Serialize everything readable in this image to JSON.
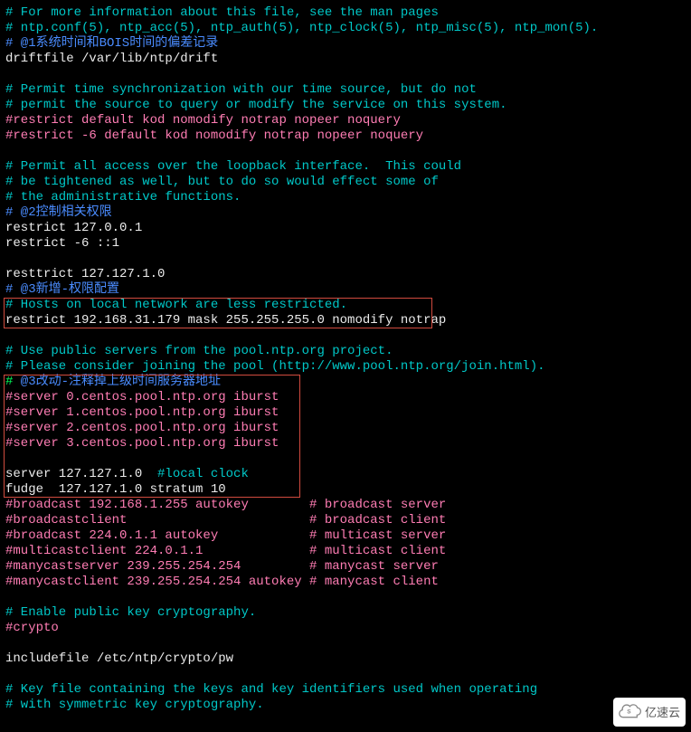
{
  "lines": [
    {
      "parts": [
        {
          "cls": "c-teal",
          "text": "# For more information about this file, see the man pages"
        }
      ]
    },
    {
      "parts": [
        {
          "cls": "c-teal",
          "text": "# ntp.conf(5), ntp_acc(5), ntp_auth(5), ntp_clock(5), ntp_misc(5), ntp_mon(5)."
        }
      ]
    },
    {
      "parts": [
        {
          "cls": "c-blue",
          "text": "# @1系统时间和BOIS时间的偏差记录"
        }
      ]
    },
    {
      "parts": [
        {
          "cls": "c-white",
          "text": "driftfile /var/lib/ntp/drift"
        }
      ]
    },
    {
      "parts": [
        {
          "cls": "c-white",
          "text": ""
        }
      ]
    },
    {
      "parts": [
        {
          "cls": "c-teal",
          "text": "# Permit time synchronization with our time source, but do not"
        }
      ]
    },
    {
      "parts": [
        {
          "cls": "c-teal",
          "text": "# permit the source to query or modify the service on this system."
        }
      ]
    },
    {
      "parts": [
        {
          "cls": "c-pink",
          "text": "#restrict default kod nomodify notrap nopeer noquery"
        }
      ]
    },
    {
      "parts": [
        {
          "cls": "c-pink",
          "text": "#restrict -6 default kod nomodify notrap nopeer noquery"
        }
      ]
    },
    {
      "parts": [
        {
          "cls": "c-white",
          "text": ""
        }
      ]
    },
    {
      "parts": [
        {
          "cls": "c-teal",
          "text": "# Permit all access over the loopback interface.  This could"
        }
      ]
    },
    {
      "parts": [
        {
          "cls": "c-teal",
          "text": "# be tightened as well, but to do so would effect some of"
        }
      ]
    },
    {
      "parts": [
        {
          "cls": "c-teal",
          "text": "# the administrative functions."
        }
      ]
    },
    {
      "parts": [
        {
          "cls": "c-blue",
          "text": "# @2控制相关权限"
        }
      ]
    },
    {
      "parts": [
        {
          "cls": "c-white",
          "text": "restrict 127.0.0.1"
        }
      ]
    },
    {
      "parts": [
        {
          "cls": "c-white",
          "text": "restrict -6 ::1"
        }
      ]
    },
    {
      "parts": [
        {
          "cls": "c-white",
          "text": ""
        }
      ]
    },
    {
      "parts": [
        {
          "cls": "c-white",
          "text": "resttrict 127.127.1.0"
        }
      ]
    },
    {
      "parts": [
        {
          "cls": "c-blue",
          "text": "# @3新增-权限配置"
        }
      ]
    },
    {
      "parts": [
        {
          "cls": "c-teal",
          "text": "# Hosts on local network are less restricted."
        }
      ]
    },
    {
      "parts": [
        {
          "cls": "c-white",
          "text": "restrict 192.168.31.179 mask 255.255.255.0 nomodify notrap"
        }
      ]
    },
    {
      "parts": [
        {
          "cls": "c-white",
          "text": ""
        }
      ]
    },
    {
      "parts": [
        {
          "cls": "c-teal",
          "text": "# Use public servers from the pool.ntp.org project."
        }
      ]
    },
    {
      "parts": [
        {
          "cls": "c-teal",
          "text": "# Please consider joining the pool (http://www.pool.ntp.org/join.html)."
        }
      ]
    },
    {
      "parts": [
        {
          "cls": "c-green",
          "text": "#"
        },
        {
          "cls": "c-blue",
          "text": " @3改动-注释掉上级时间服务器地址"
        }
      ]
    },
    {
      "parts": [
        {
          "cls": "c-pink",
          "text": "#server 0.centos.pool.ntp.org iburst"
        }
      ]
    },
    {
      "parts": [
        {
          "cls": "c-pink",
          "text": "#server 1.centos.pool.ntp.org iburst"
        }
      ]
    },
    {
      "parts": [
        {
          "cls": "c-pink",
          "text": "#server 2.centos.pool.ntp.org iburst"
        }
      ]
    },
    {
      "parts": [
        {
          "cls": "c-pink",
          "text": "#server 3.centos.pool.ntp.org iburst"
        }
      ]
    },
    {
      "parts": [
        {
          "cls": "c-white",
          "text": ""
        }
      ]
    },
    {
      "parts": [
        {
          "cls": "c-white",
          "text": "server 127.127.1.0  "
        },
        {
          "cls": "c-teal",
          "text": "#local clock"
        }
      ]
    },
    {
      "parts": [
        {
          "cls": "c-white",
          "text": "fudge  127.127.1.0 stratum 10"
        }
      ]
    },
    {
      "parts": [
        {
          "cls": "c-pink",
          "text": "#broadcast 192.168.1.255 autokey        # broadcast server"
        }
      ]
    },
    {
      "parts": [
        {
          "cls": "c-pink",
          "text": "#broadcastclient                        # broadcast client"
        }
      ]
    },
    {
      "parts": [
        {
          "cls": "c-pink",
          "text": "#broadcast 224.0.1.1 autokey            # multicast server"
        }
      ]
    },
    {
      "parts": [
        {
          "cls": "c-pink",
          "text": "#multicastclient 224.0.1.1              # multicast client"
        }
      ]
    },
    {
      "parts": [
        {
          "cls": "c-pink",
          "text": "#manycastserver 239.255.254.254         # manycast server"
        }
      ]
    },
    {
      "parts": [
        {
          "cls": "c-pink",
          "text": "#manycastclient 239.255.254.254 autokey # manycast client"
        }
      ]
    },
    {
      "parts": [
        {
          "cls": "c-white",
          "text": ""
        }
      ]
    },
    {
      "parts": [
        {
          "cls": "c-teal",
          "text": "# Enable public key cryptography."
        }
      ]
    },
    {
      "parts": [
        {
          "cls": "c-pink",
          "text": "#crypto"
        }
      ]
    },
    {
      "parts": [
        {
          "cls": "c-white",
          "text": ""
        }
      ]
    },
    {
      "parts": [
        {
          "cls": "c-white",
          "text": "includefile /etc/ntp/crypto/pw"
        }
      ]
    },
    {
      "parts": [
        {
          "cls": "c-white",
          "text": ""
        }
      ]
    },
    {
      "parts": [
        {
          "cls": "c-teal",
          "text": "# Key file containing the keys and key identifiers used when operating"
        }
      ]
    },
    {
      "parts": [
        {
          "cls": "c-teal",
          "text": "# with symmetric key cryptography."
        }
      ]
    }
  ],
  "watermark": {
    "text": "亿速云"
  }
}
